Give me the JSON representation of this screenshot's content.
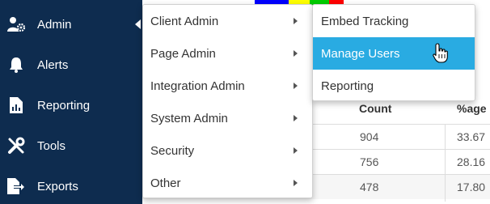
{
  "sidebar": {
    "items": [
      {
        "label": "Admin",
        "icon": "user-gear-icon"
      },
      {
        "label": "Alerts",
        "icon": "bell-icon"
      },
      {
        "label": "Reporting",
        "icon": "report-icon"
      },
      {
        "label": "Tools",
        "icon": "tools-icon"
      },
      {
        "label": "Exports",
        "icon": "export-icon"
      }
    ]
  },
  "admin_menu": {
    "items": [
      {
        "label": "Client Admin"
      },
      {
        "label": "Page Admin"
      },
      {
        "label": "Integration Admin"
      },
      {
        "label": "System Admin"
      },
      {
        "label": "Security"
      },
      {
        "label": "Other"
      }
    ]
  },
  "client_admin_submenu": {
    "items": [
      {
        "label": "Embed Tracking"
      },
      {
        "label": "Manage Users",
        "active": true
      },
      {
        "label": "Reporting"
      }
    ]
  },
  "table": {
    "headers": {
      "count": "Count",
      "pct": "%age"
    },
    "rows": [
      {
        "count": "904",
        "pct": "33.67"
      },
      {
        "count": "756",
        "pct": "28.16"
      },
      {
        "count": "478",
        "pct": "17.80"
      }
    ]
  },
  "colors": {
    "sidebar": "#0e2c4f",
    "active_item": "#29abe2",
    "pie": [
      "#0000ff",
      "#ffff00",
      "#00cc00",
      "#ff0000"
    ]
  }
}
